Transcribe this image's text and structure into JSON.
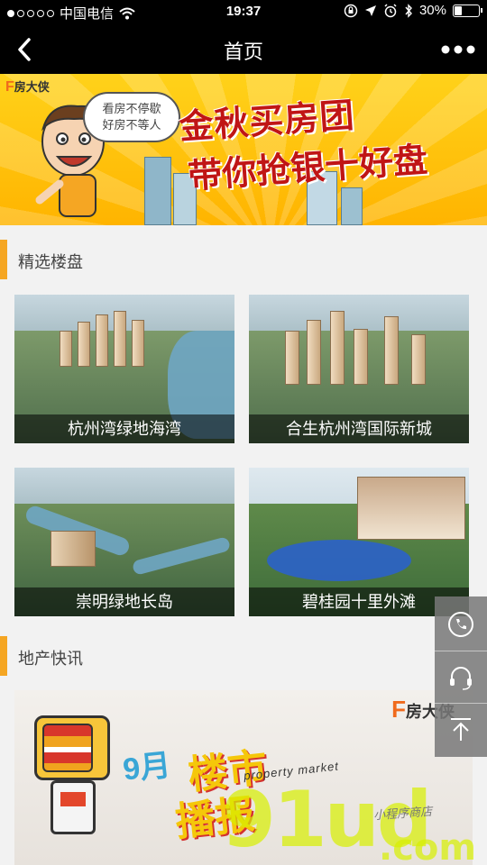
{
  "status_bar": {
    "carrier": "中国电信",
    "time": "19:37",
    "battery": "30%",
    "battery_level": 0.3
  },
  "nav": {
    "title": "首页"
  },
  "banner": {
    "brand": "房大侠",
    "bubble_line1": "看房不停歇",
    "bubble_line2": "好房不等人",
    "headline_line1": "金秋买房团",
    "headline_line2": "带你抢银十好盘"
  },
  "featured": {
    "section_title": "精选楼盘",
    "properties": [
      {
        "name": "杭州湾绿地海湾"
      },
      {
        "name": "合生杭州湾国际新城"
      },
      {
        "name": "崇明绿地长岛"
      },
      {
        "name": "碧桂园十里外滩"
      }
    ]
  },
  "news": {
    "section_title": "地产快讯",
    "brand": "房大侠",
    "month": "9月",
    "title_line1": "楼市",
    "title_line2": "播报",
    "subtitle": "property market"
  },
  "watermark": {
    "main": "91ud",
    "suffix": ".com",
    "caption": "小程序商店"
  },
  "icons": {
    "back": "chevron-left-icon",
    "more": "more-dots-icon",
    "phone": "phone-icon",
    "support": "headset-icon",
    "top": "back-to-top-icon"
  }
}
